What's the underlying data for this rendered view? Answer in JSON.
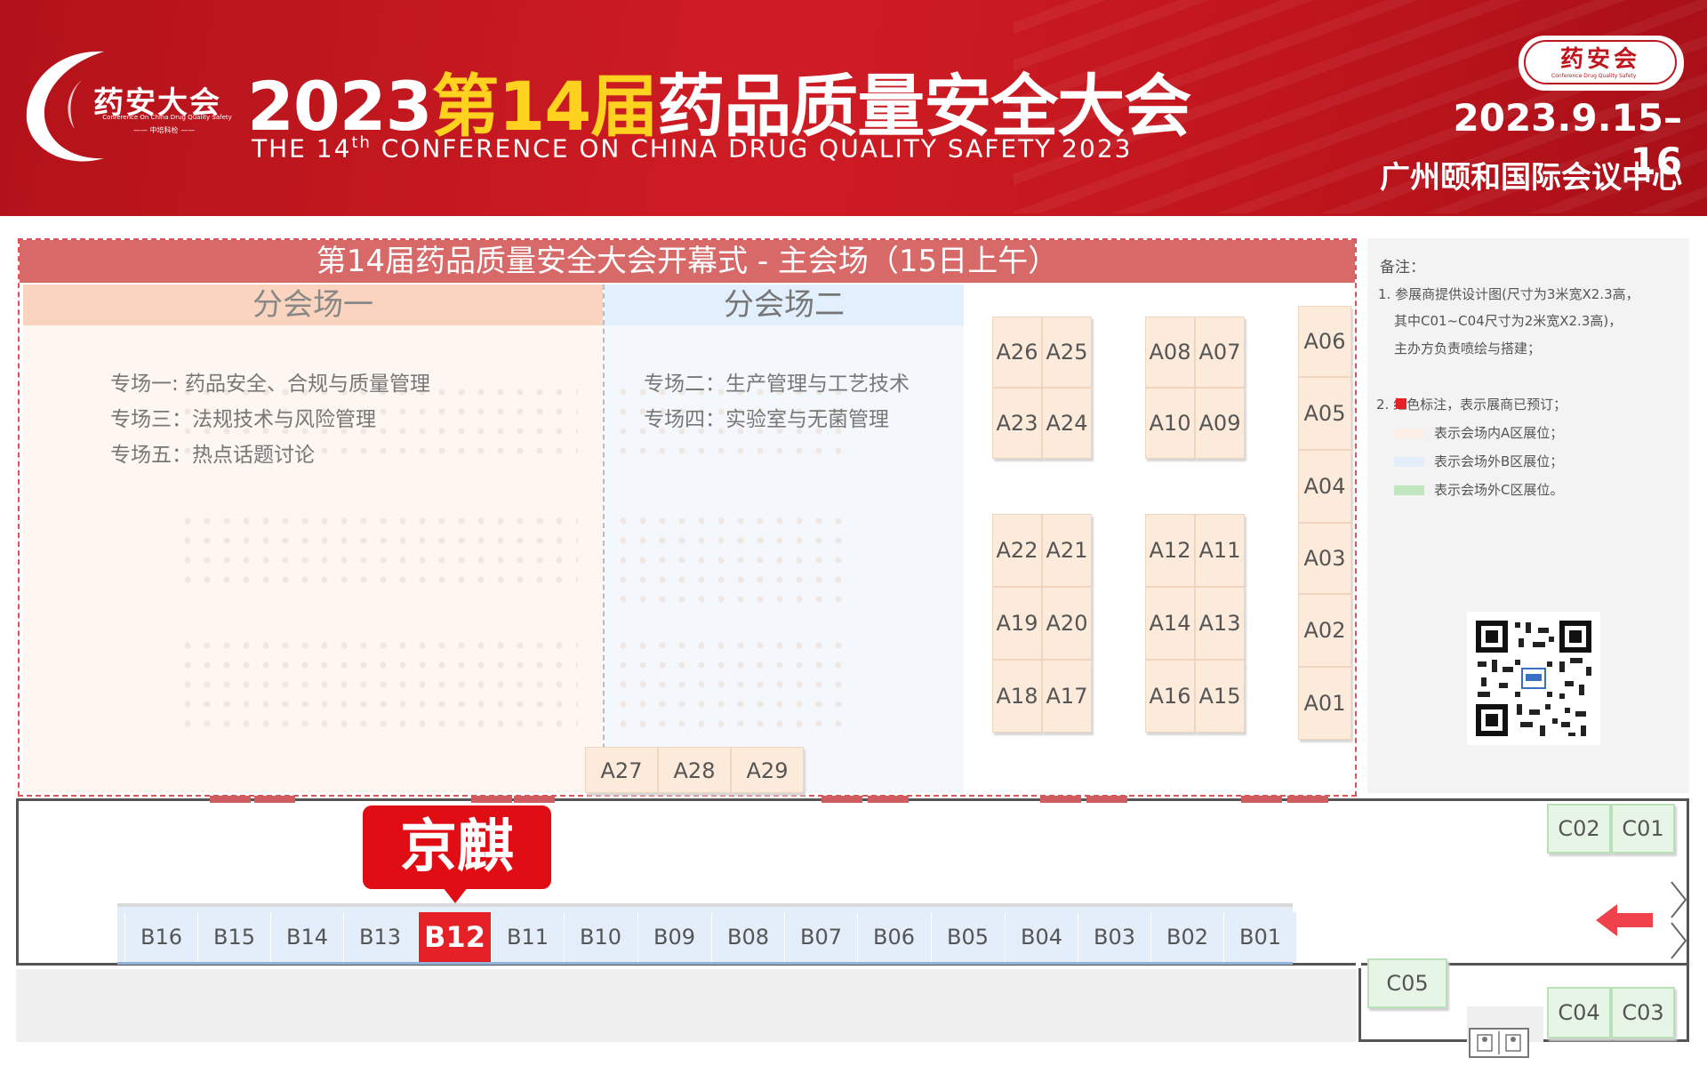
{
  "header": {
    "logo_text": "药安大会",
    "logo_subtitle": "Conference On China Drug Quality Safety",
    "logo_company": "—— 中培科检 ——",
    "title_year": "2023",
    "title_edition": "第14届",
    "title_name": "药品质量安全大会",
    "title_en_pre": "THE 14",
    "title_en_sup": "th",
    "title_en_post": " CONFERENCE ON CHINA DRUG QUALITY SAFETY 2023",
    "badge": "药安会",
    "badge_sub": "Conference Drug Quality Safety",
    "date": "2023.9.15– 16",
    "venue": "广州颐和国际会议中心"
  },
  "hall": {
    "opening": "第14届药品质量安全大会开幕式 - 主会场（15日上午）",
    "sub1": {
      "title": "分会场一",
      "sessions": [
        "专场一:  药品安全、合规与质量管理",
        "专场三：法规技术与风险管理",
        "专场五：热点话题讨论"
      ]
    },
    "sub2": {
      "title": "分会场二",
      "sessions": [
        "专场二：生产管理与工艺技术",
        "专场四：实验室与无菌管理"
      ]
    }
  },
  "booths_a": {
    "grid1": [
      "A26",
      "A25",
      "A23",
      "A24"
    ],
    "grid2": [
      "A08",
      "A07",
      "A10",
      "A09"
    ],
    "grid3": [
      "A22",
      "A21",
      "A19",
      "A20",
      "A18",
      "A17"
    ],
    "grid4": [
      "A12",
      "A11",
      "A14",
      "A13",
      "A16",
      "A15"
    ],
    "column": [
      "A06",
      "A05",
      "A04",
      "A03",
      "A02",
      "A01"
    ],
    "bottom": [
      "A27",
      "A28",
      "A29"
    ]
  },
  "booths_b": [
    "B16",
    "B15",
    "B14",
    "B13",
    "B12",
    "B11",
    "B10",
    "B09",
    "B08",
    "B07",
    "B06",
    "B05",
    "B04",
    "B03",
    "B02",
    "B01"
  ],
  "reserved": {
    "booth": "B12",
    "company": "京麒"
  },
  "booths_c": [
    "C02",
    "C01",
    "C05",
    "C04",
    "C03"
  ],
  "legend": {
    "title": "备注：",
    "note1_lines": [
      "1. 参展商提供设计图(尺寸为3米宽X2.3高，",
      "其中C01~C04尺寸为2米宽X2.3高)，",
      "主办方负责喷绘与搭建；"
    ],
    "note2": "2.      红色标注，表示展商已预订；",
    "items": [
      {
        "color": "#fdeee8",
        "label": "表示会场内A区展位；"
      },
      {
        "color": "#e4eefa",
        "label": "表示会场外B区展位；"
      },
      {
        "color": "#bfe6bf",
        "label": "表示会场外C区展位。"
      }
    ],
    "reserved_color": "#e52026"
  },
  "colors": {
    "header_red": "#c0151d",
    "highlight_yellow": "#ffd21f",
    "reserved_red": "#e52026"
  }
}
